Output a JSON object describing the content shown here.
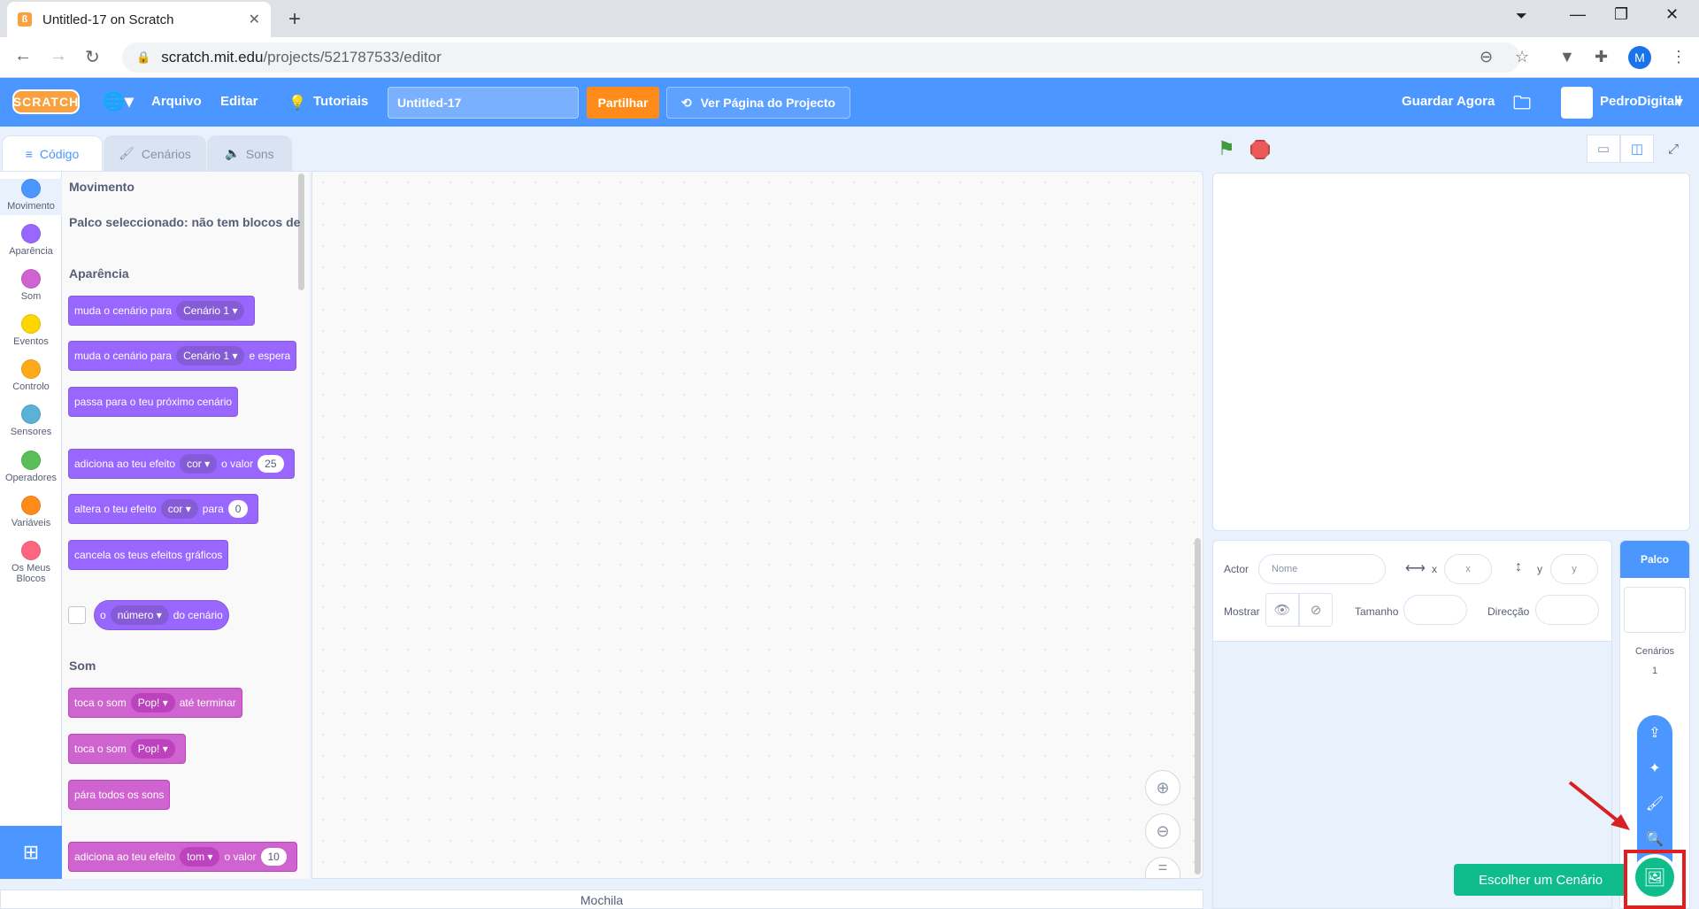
{
  "browser": {
    "tab_title": "Untitled-17 on Scratch",
    "url_host": "scratch.mit.edu",
    "url_path": "/projects/521787533/editor",
    "profile_initial": "M"
  },
  "menubar": {
    "logo": "SCRATCH",
    "file": "Arquivo",
    "edit": "Editar",
    "tutorials": "Tutoriais",
    "project_title": "Untitled-17",
    "share": "Partilhar",
    "project_page": "Ver Página do Projecto",
    "save_now": "Guardar Agora",
    "username": "PedroDigitall"
  },
  "tabs": {
    "code": "Código",
    "backdrops": "Cenários",
    "sounds": "Sons"
  },
  "categories": [
    {
      "label": "Movimento",
      "color": "#4c97ff"
    },
    {
      "label": "Aparência",
      "color": "#9966ff"
    },
    {
      "label": "Som",
      "color": "#cf63cf"
    },
    {
      "label": "Eventos",
      "color": "#ffd500"
    },
    {
      "label": "Controlo",
      "color": "#ffab19"
    },
    {
      "label": "Sensores",
      "color": "#5cb1d6"
    },
    {
      "label": "Operadores",
      "color": "#59c059"
    },
    {
      "label": "Variáveis",
      "color": "#ff8c1a"
    },
    {
      "label": "Os Meus Blocos",
      "color": "#ff6680"
    }
  ],
  "palette": {
    "motion_title": "Movimento",
    "motion_note": "Palco seleccionado: não tem blocos de",
    "looks_title": "Aparência",
    "sound_title": "Som",
    "blocks": {
      "b1_text": "muda o cenário para",
      "b1_dd": "Cenário 1",
      "b2_text": "muda o cenário para",
      "b2_dd": "Cenário 1",
      "b2_tail": "e espera",
      "b3_text": "passa para o teu próximo cenário",
      "b4_text": "adiciona ao teu efeito",
      "b4_dd": "cor",
      "b4_mid": "o valor",
      "b4_num": "25",
      "b5_text": "altera o teu efeito",
      "b5_dd": "cor",
      "b5_mid": "para",
      "b5_num": "0",
      "b6_text": "cancela os teus efeitos gráficos",
      "b7_o": "o",
      "b7_dd": "número",
      "b7_tail": "do cenário",
      "s1_text": "toca o som",
      "s1_dd": "Pop!",
      "s1_tail": "até terminar",
      "s2_text": "toca o som",
      "s2_dd": "Pop!",
      "s3_text": "pára todos os sons",
      "s4_text": "adiciona ao teu efeito",
      "s4_dd": "tom",
      "s4_mid": "o valor",
      "s4_num": "10"
    }
  },
  "backpack": "Mochila",
  "sprite_info": {
    "sprite_label": "Actor",
    "name_placeholder": "Nome",
    "x_label": "x",
    "x_placeholder": "x",
    "y_label": "y",
    "y_placeholder": "y",
    "show_label": "Mostrar",
    "size_label": "Tamanho",
    "direction_label": "Direcção"
  },
  "stage_pane": {
    "header": "Palco",
    "backdrops_label": "Cenários",
    "backdrops_count": "1"
  },
  "tooltip": "Escolher um Cenário"
}
